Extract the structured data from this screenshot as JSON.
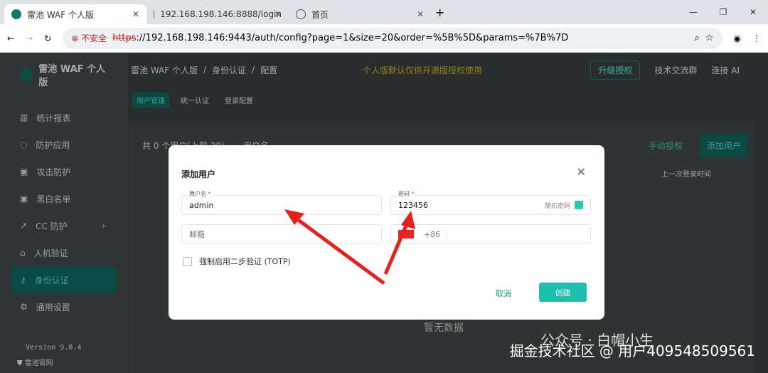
{
  "browser": {
    "tabs": [
      {
        "title": "雷池 WAF 个人版",
        "active": true
      },
      {
        "title": "192.168.198.146:8888/login"
      },
      {
        "title": "首页"
      }
    ],
    "security_label": "不安全",
    "url_scheme": "https",
    "url_rest": "://192.168.198.146:9443/auth/config?page=1&size=20&order=%5B%5D&params=%7B%7D"
  },
  "app": {
    "logo": "雷池 WAF 个人版",
    "breadcrumb": [
      "雷池 WAF 个人版",
      "身份认证",
      "配置"
    ],
    "notice": "个人版默认仅供开源版授权使用",
    "upgrade": "升级授权",
    "community": "技术交流群",
    "ai": "连接 AI",
    "nav": [
      "统计报表",
      "防护应用",
      "攻击防护",
      "黑白名单",
      "CC 防护",
      "人机验证",
      "身份认证",
      "通用设置"
    ],
    "version": "Version 9.0.4",
    "site": "雷池官网",
    "subtabs": [
      "用户管理",
      "统一认证",
      "登录配置"
    ],
    "count": "共 0 个用户(上限 20)",
    "col_user": "用户名",
    "manual": "手动授权",
    "add_user": "添加用户",
    "col_last": "上一次登录时间",
    "empty": "暂无数据"
  },
  "modal": {
    "title": "添加用户",
    "username_label": "用户名",
    "username": "admin",
    "password_label": "密码",
    "password": "123456",
    "random": "随机密码",
    "email_placeholder": "邮箱",
    "phone_prefix": "+86",
    "totp": "强制启用二步验证 (TOTP)",
    "cancel": "取消",
    "create": "创建"
  },
  "watermark": {
    "wechat": "公众号 · 白帽小生",
    "site": "掘金技术社区 @ 用户409548509561"
  }
}
